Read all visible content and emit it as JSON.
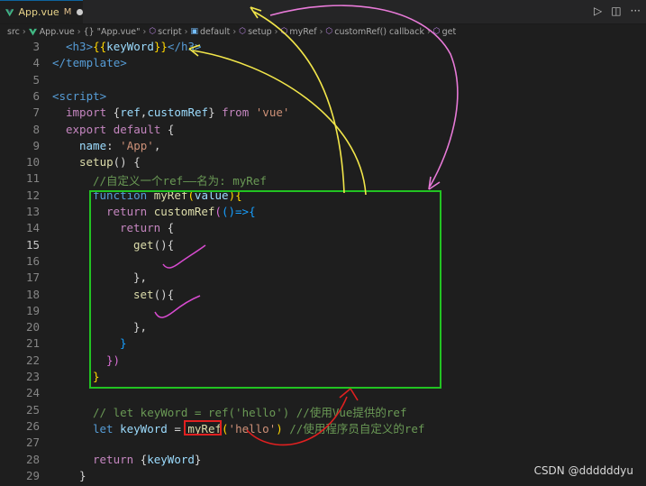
{
  "tab": {
    "filename": "App.vue",
    "status": "M"
  },
  "breadcrumb": [
    "src",
    "App.vue",
    "{} \"App.vue\"",
    "script",
    "default",
    "setup",
    "myRef",
    "customRef() callback",
    "get"
  ],
  "editor": {
    "line_numbers": [
      "3",
      "4",
      "5",
      "6",
      "7",
      "8",
      "9",
      "10",
      "11",
      "12",
      "13",
      "14",
      "15",
      "16",
      "17",
      "18",
      "19",
      "20",
      "21",
      "22",
      "23",
      "24",
      "25",
      "26",
      "27",
      "28",
      "29"
    ],
    "active_line": "15",
    "lines": {
      "l3": [
        "<h3>",
        "{{",
        "keyWord",
        "}}",
        "</h3>"
      ],
      "l4": [
        "</template>"
      ],
      "l6": [
        "<script>"
      ],
      "l7": [
        "import",
        " {",
        "ref",
        ",",
        "customRef",
        "} ",
        "from",
        " ",
        "'vue'"
      ],
      "l8": [
        "export",
        " ",
        "default",
        " {"
      ],
      "l9": [
        "name",
        ": ",
        "'App'",
        ","
      ],
      "l10": [
        "setup",
        "() {"
      ],
      "l11": [
        "//自定义一个ref——名为: myRef"
      ],
      "l12": [
        "function",
        " ",
        "myRef",
        "(",
        "value",
        "){"
      ],
      "l13": [
        "return",
        " ",
        "customRef",
        "(",
        "()",
        "=>{"
      ],
      "l14": [
        "return",
        " {"
      ],
      "l15": [
        "get",
        "(){"
      ],
      "l17": [
        "},"
      ],
      "l18": [
        "set",
        "(){"
      ],
      "l20": [
        "},"
      ],
      "l21": [
        "}"
      ],
      "l22": [
        "})"
      ],
      "l23": [
        "}"
      ],
      "l25": [
        "// let keyWord = ref('hello') //使用Vue提供的ref"
      ],
      "l26": [
        "let",
        " ",
        "keyWord",
        " = ",
        "myRef",
        "(",
        "'hello'",
        ") ",
        "//使用程序员自定义的ref"
      ],
      "l28": [
        "return",
        " {",
        "keyWord",
        "}"
      ],
      "l29": [
        "}"
      ]
    }
  },
  "watermark": "CSDN @ddddddyu",
  "colors": {
    "green_box": "#22c322",
    "red_box": "#e02020",
    "yellow_annotation": "#f2e64a",
    "pink_annotation": "#e87ad8",
    "check_marks": "#d84bd0"
  }
}
